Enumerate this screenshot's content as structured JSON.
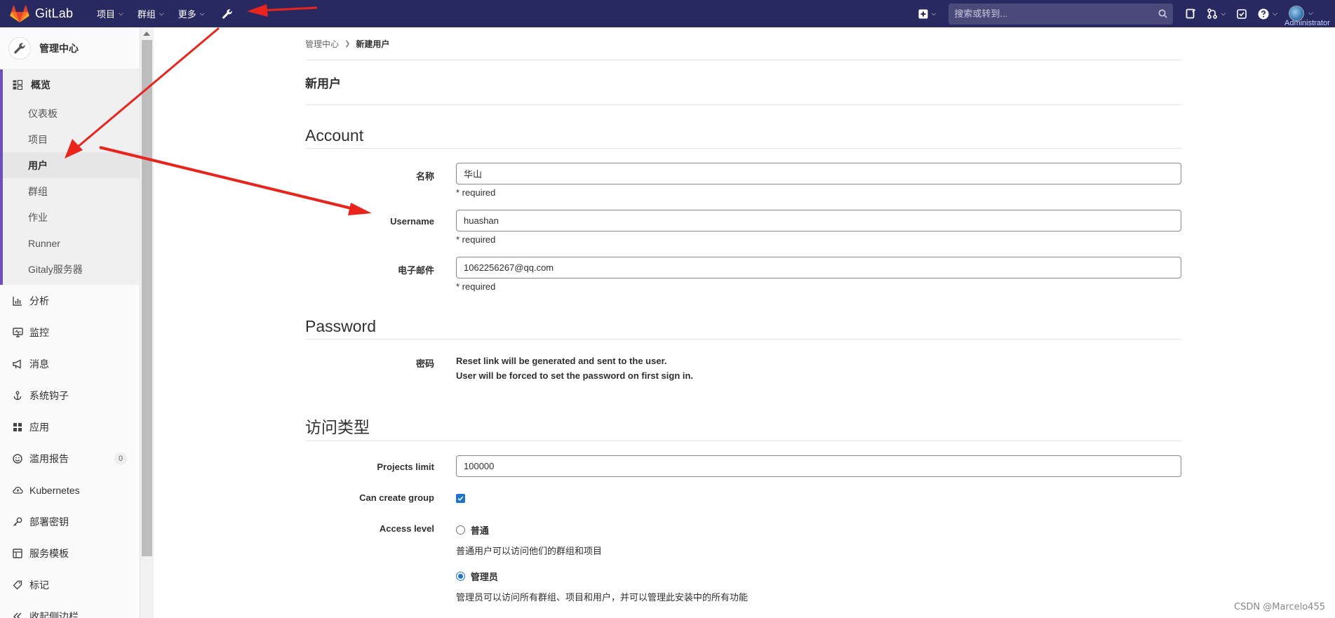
{
  "navbar": {
    "brand": "GitLab",
    "menu": [
      {
        "label": "项目"
      },
      {
        "label": "群组"
      },
      {
        "label": "更多"
      }
    ],
    "search_placeholder": "搜索或转到...",
    "user_name": "Administrator"
  },
  "sidebar": {
    "title": "管理中心",
    "overview": {
      "label": "概览",
      "items": [
        "仪表板",
        "项目",
        "用户",
        "群组",
        "作业",
        "Runner",
        "Gitaly服务器"
      ]
    },
    "items": [
      {
        "label": "分析",
        "icon": "chart-icon"
      },
      {
        "label": "监控",
        "icon": "monitor-icon"
      },
      {
        "label": "消息",
        "icon": "megaphone-icon"
      },
      {
        "label": "系统钩子",
        "icon": "hook-icon"
      },
      {
        "label": "应用",
        "icon": "apps-icon"
      },
      {
        "label": "滥用报告",
        "icon": "smiley-icon",
        "badge": "0"
      },
      {
        "label": "Kubernetes",
        "icon": "kubernetes-icon"
      },
      {
        "label": "部署密钥",
        "icon": "key-icon"
      },
      {
        "label": "服务模板",
        "icon": "template-icon"
      },
      {
        "label": "标记",
        "icon": "label-icon"
      },
      {
        "label": "收起侧边栏",
        "icon": "collapse-icon"
      }
    ]
  },
  "breadcrumb": {
    "parent": "管理中心",
    "current": "新建用户"
  },
  "page_title": "新用户",
  "account": {
    "title": "Account",
    "name_label": "名称",
    "name_value": "华山",
    "username_label": "Username",
    "username_value": "huashan",
    "email_label": "电子邮件",
    "email_value": "1062256267@qq.com",
    "required_text": "* required"
  },
  "password": {
    "title": "Password",
    "label": "密码",
    "line1": "Reset link will be generated and sent to the user.",
    "line2": "User will be forced to set the password on first sign in."
  },
  "access": {
    "title": "访问类型",
    "projects_limit_label": "Projects limit",
    "projects_limit_value": "100000",
    "can_create_group_label": "Can create group",
    "can_create_group": true,
    "access_level_label": "Access level",
    "regular_label": "普通",
    "regular_help": "普通用户可以访问他们的群组和项目",
    "admin_label": "管理员",
    "admin_help": "管理员可以访问所有群组、项目和用户，并可以管理此安装中的所有功能",
    "selected": "admin"
  },
  "watermark": "CSDN @Marcelo455",
  "colors": {
    "navbar": "#292961",
    "accent": "#1f75cb",
    "sidebar_active_border": "#6b4fbb",
    "annotation_arrow": "#e8241c"
  }
}
